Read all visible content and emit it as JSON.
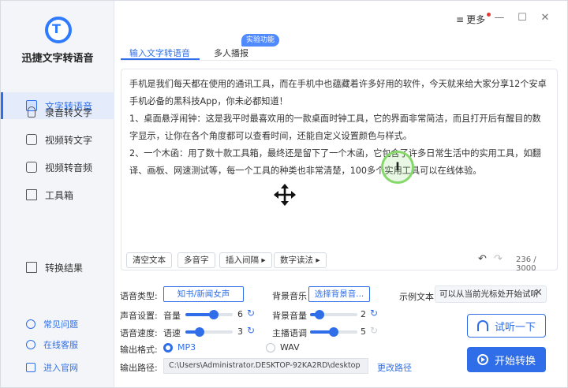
{
  "sidebar": {
    "app_name": "迅捷文字转语音",
    "items": [
      {
        "label": "文字转语音"
      },
      {
        "label": "录音转文字"
      },
      {
        "label": "视频转文字"
      },
      {
        "label": "视频转音频"
      },
      {
        "label": "工具箱"
      },
      {
        "label": "转换结果"
      }
    ],
    "help": [
      {
        "label": "常见问题"
      },
      {
        "label": "在线客服"
      },
      {
        "label": "进入官网"
      }
    ]
  },
  "titlebar": {
    "more_label": "更多",
    "menu_icon": "≡",
    "minimize_icon": "—",
    "maximize_icon": "☐",
    "close_icon": "✕"
  },
  "tabs": [
    {
      "label": "输入文字转语音",
      "active": true
    },
    {
      "label": "多人播报",
      "badge": "实验功能"
    }
  ],
  "editor": {
    "paragraphs": [
      "手机是我们每天都在使用的通讯工具，而在手机中也蕴藏着许多好用的软件，今天就来给大家分享12个安卓手机必备的黑科技App，你未必都知道！",
      "1、桌面悬浮闹钟：这是我平时最喜欢用的一款桌面时钟工具，它的界面非常简洁，而且打开后有醒目的数字显示，让你在各个角度都可以查看时间，还能自定义设置颜色与样式。",
      "2、一个木函：用了数十款工具箱，最终还是留下了一个木函，它包含了许多日常生活中的实用工具，如翻译、画板、网速测试等，每一个工具的种类也非常清楚，100多个实用工具可以在线体验。"
    ],
    "toolbar": {
      "clear": "清空文本",
      "polyphone": "多音字",
      "insert_pause": "插入间隔 ▸",
      "digit_reading": "数字读法 ▸"
    },
    "undo_icon": "↶",
    "redo_icon": "↷",
    "counter": "236 / 3000"
  },
  "settings": {
    "voice_type_label": "语音类型:",
    "voice_type_value": "知书/新闻女声",
    "bg_music_label": "背景音乐",
    "bg_music_value": "选择背景音...",
    "sound_label": "声音设置:",
    "volume_label": "音量",
    "volume_value": "6",
    "volume_level": 0.6,
    "bg_volume_label": "背景音量",
    "bg_volume_value": "2",
    "bg_volume_level": 0.2,
    "speed_label": "语音速度:",
    "speed_sub_label": "语速",
    "speed_value": "3",
    "speed_level": 0.3,
    "pitch_label": "主播语调",
    "pitch_value": "5",
    "pitch_level": 0.5,
    "format_label": "输出格式:",
    "format_mp3": "MP3",
    "format_wav": "WAV",
    "path_label": "输出路径:",
    "path_value": "C:\\Users\\Administrator.DESKTOP-92KA2RD\\desktop",
    "change_path": "更改路径"
  },
  "sample": {
    "label": "示例文本",
    "value": "可以从当前光标处开始试听",
    "close_icon": "✕"
  },
  "actions": {
    "listen": "试听一下",
    "start": "开始转换"
  },
  "colors": {
    "accent": "#2f6ee8",
    "sidebar_bg": "#f3f5f9",
    "cursor_highlight": "#86d86b"
  }
}
